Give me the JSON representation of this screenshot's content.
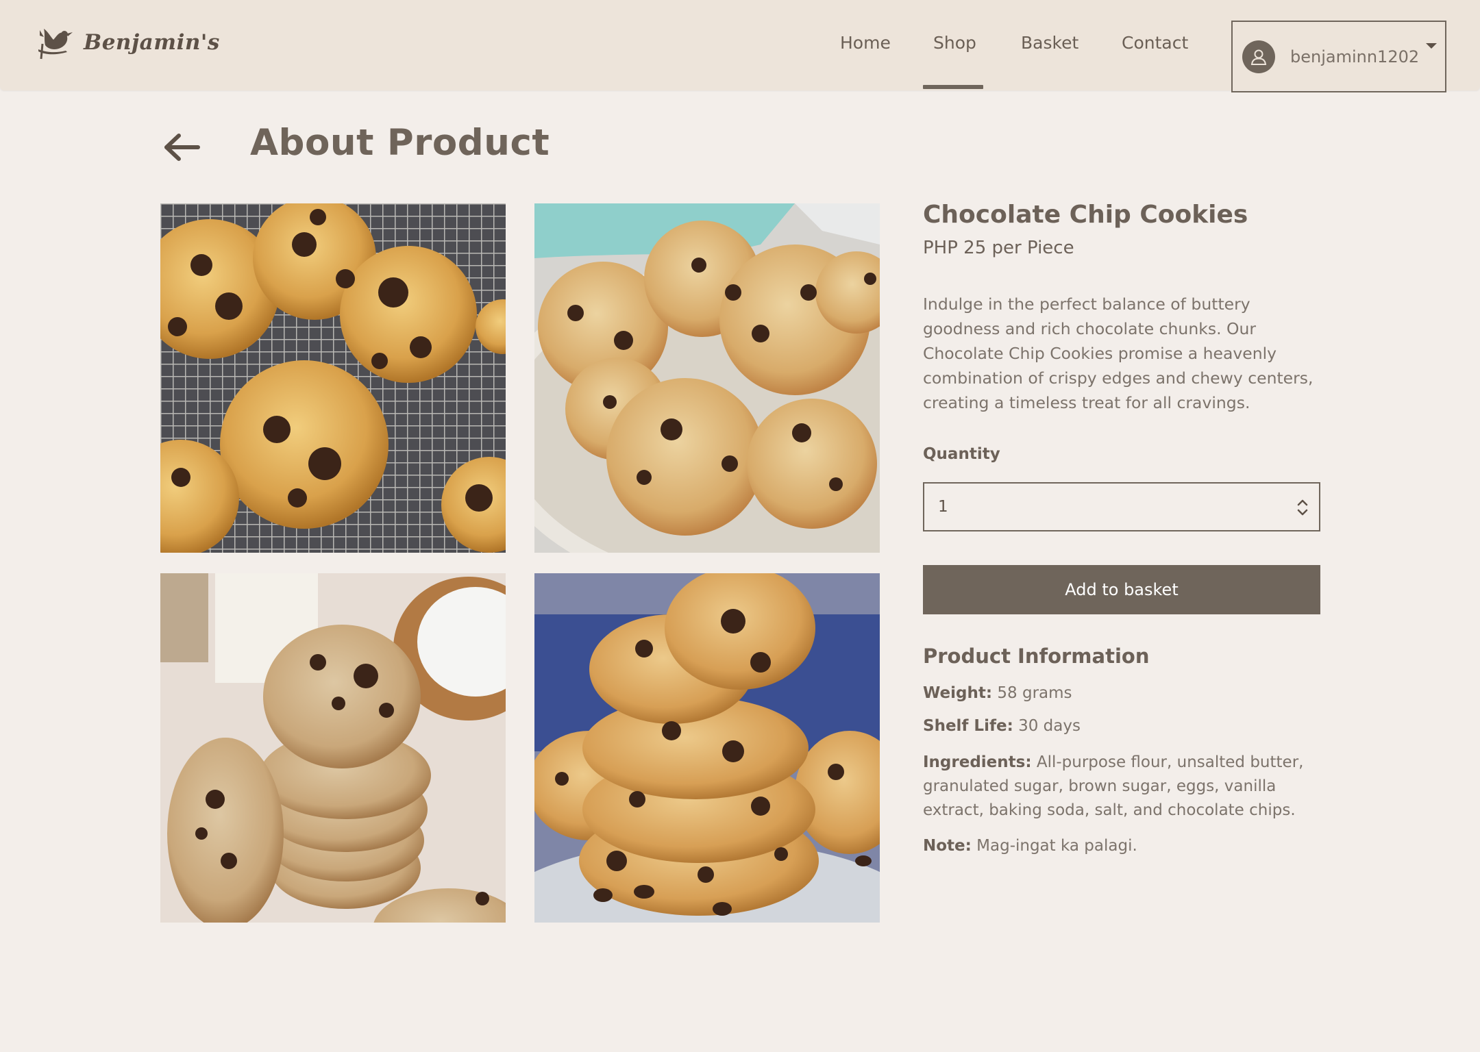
{
  "brand": {
    "name": "Benjamin's"
  },
  "nav": {
    "items": [
      {
        "label": "Home"
      },
      {
        "label": "Shop"
      },
      {
        "label": "Basket"
      },
      {
        "label": "Contact"
      }
    ],
    "active": "Shop"
  },
  "user": {
    "username": "benjaminn1202",
    "avatar_icon": "user-icon",
    "menu_icon": "caret-down-icon"
  },
  "page": {
    "title": "About Product",
    "back_icon": "arrow-left-icon"
  },
  "gallery": {
    "images": [
      "cookies on cooling rack",
      "cookies on plate",
      "cookie stack with milk",
      "stacked chocolate chip cookies"
    ]
  },
  "product": {
    "name": "Chocolate Chip Cookies",
    "price": "PHP 25 per Piece",
    "description": "Indulge in the perfect balance of buttery goodness and rich chocolate chunks. Our Chocolate Chip Cookies promise a heavenly combination of crispy edges and chewy centers, creating a timeless treat for all cravings.",
    "quantity_label": "Quantity",
    "quantity_value": "1",
    "add_button": "Add to basket"
  },
  "product_info": {
    "title": "Product Information",
    "weight_label": "Weight:",
    "weight_value": "58 grams",
    "shelf_label": "Shelf Life:",
    "shelf_value": "30 days",
    "ingredients_label": "Ingredients:",
    "ingredients_value": "All-purpose flour, unsalted butter, granulated sugar, brown sugar, eggs, vanilla extract, baking soda, salt, and chocolate chips.",
    "note_label": "Note:",
    "note_value": "Mag-ingat ka palagi."
  },
  "colors": {
    "background": "#f3eeea",
    "header": "#ede4da",
    "accent": "#6f655b",
    "text": "#6f645a"
  }
}
